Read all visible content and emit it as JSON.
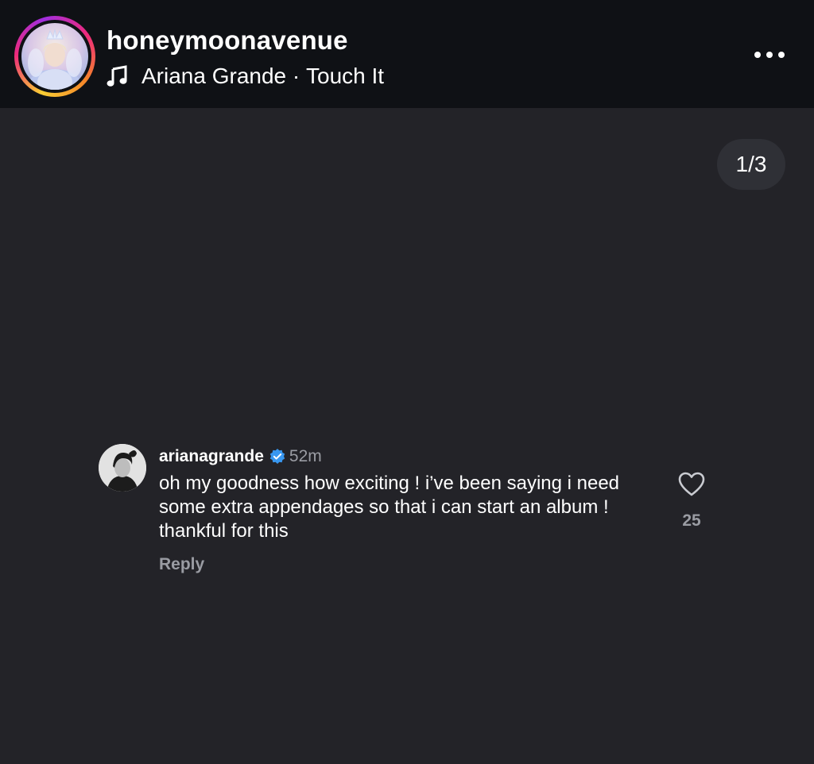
{
  "post_header": {
    "username": "honeymoonavenue",
    "music": {
      "icon": "music-note-icon",
      "artist": "Ariana Grande",
      "separator": " · ",
      "track": "Touch It"
    },
    "more_icon": "more-horizontal-icon"
  },
  "carousel": {
    "counter": "1/3"
  },
  "comment": {
    "username": "arianagrande",
    "verified_icon": "verified-badge-icon",
    "time": "52m",
    "text": "oh my goodness how exciting ! i’ve been saying i need some extra appendages so that i can start an album ! thankful for this",
    "reply_label": "Reply",
    "like_icon": "heart-outline-icon",
    "like_count": "25"
  },
  "colors": {
    "background": "#232328",
    "header_background": "#0f1115",
    "verified_blue": "#3897f0",
    "muted_text": "#9a9ca3"
  }
}
